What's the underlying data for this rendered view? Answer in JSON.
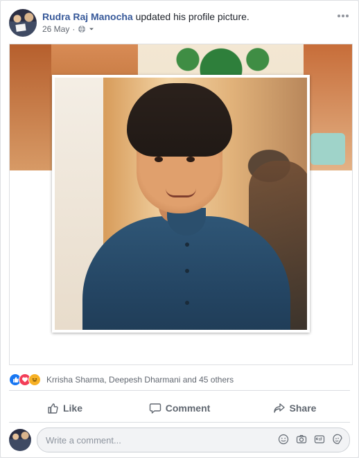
{
  "post": {
    "author_name": "Rudra Raj Manocha",
    "action_text": "updated his profile picture.",
    "date": "26 May",
    "privacy_icon": "globe-icon"
  },
  "reactions": {
    "summary_text": "Krrisha Sharma, Deepesh Dharmani and 45 others",
    "icons": [
      "like-reaction-icon",
      "love-reaction-icon",
      "haha-reaction-icon"
    ]
  },
  "actions": {
    "like_label": "Like",
    "comment_label": "Comment",
    "share_label": "Share"
  },
  "comment": {
    "placeholder": "Write a comment...",
    "icons": [
      "emoji-icon",
      "camera-icon",
      "gif-icon",
      "sticker-icon"
    ]
  },
  "colors": {
    "link": "#365899",
    "muted": "#616770",
    "like": "#1877f2",
    "love": "#f33e58",
    "haha": "#f7b125"
  }
}
